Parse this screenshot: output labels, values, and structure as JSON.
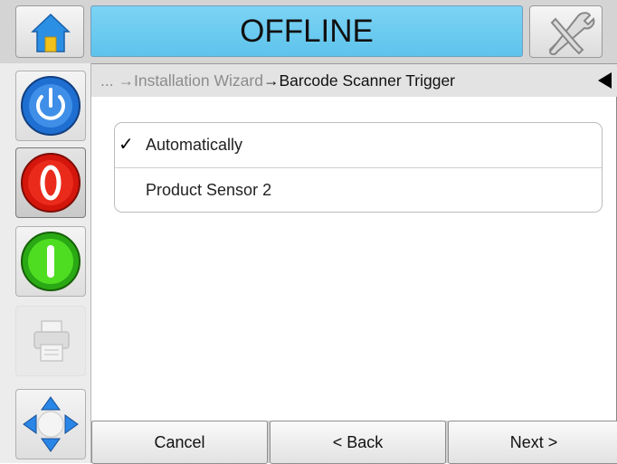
{
  "header": {
    "status": "OFFLINE",
    "home_icon": "home-icon",
    "tools_icon": "tools-icon"
  },
  "sidebar": {
    "items": [
      {
        "name": "power",
        "icon": "power-icon",
        "color": "#1e6fd1"
      },
      {
        "name": "stop",
        "icon": "stop-icon",
        "color": "#e11a10"
      },
      {
        "name": "start",
        "icon": "start-icon",
        "color": "#2fbf1a"
      },
      {
        "name": "print",
        "icon": "printer-icon",
        "color": "#bdbdbd"
      },
      {
        "name": "navigate",
        "icon": "navigation-arrows-icon",
        "color": "#2a7fe0"
      }
    ]
  },
  "breadcrumb": {
    "ellipsis": "...",
    "parent": "Installation Wizard",
    "current": "Barcode Scanner Trigger",
    "arrow": "→"
  },
  "options": {
    "items": [
      {
        "label": "Automatically",
        "selected": true
      },
      {
        "label": "Product Sensor 2",
        "selected": false
      }
    ],
    "check_glyph": "✓"
  },
  "footer": {
    "cancel": "Cancel",
    "back": "< Back",
    "next": "Next >"
  }
}
